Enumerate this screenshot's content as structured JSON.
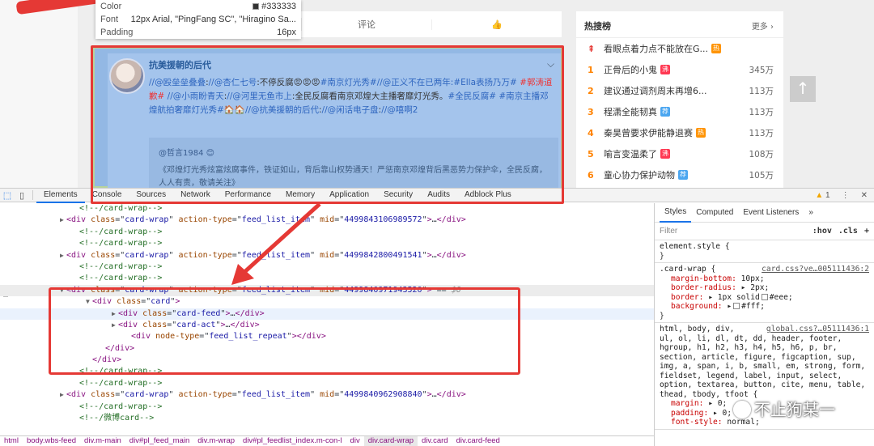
{
  "tooltip": {
    "color_label": "Color",
    "color_value": "#333333",
    "font_label": "Font",
    "font_value": "12px Arial, \"PingFang SC\", \"Hiragino Sa...",
    "padding_label": "Padding",
    "padding_value": "16px"
  },
  "feed_tabs": {
    "comment": "评论",
    "like_icon": "thumb-up-icon"
  },
  "post": {
    "author": "抗美援朝的后代",
    "text_segments": [
      {
        "t": "//",
        "c": "mention"
      },
      {
        "t": "@殴垒垒叠叠",
        "c": "mention"
      },
      {
        "t": ":",
        "c": ""
      },
      {
        "t": "//@杏仁七号",
        "c": "mention"
      },
      {
        "t": ":不停反腐",
        "c": ""
      },
      {
        "t": "😡😡😡",
        "c": ""
      },
      {
        "t": "#南京灯光秀#",
        "c": "mention"
      },
      {
        "t": "//@正义不在已两年",
        "c": "mention"
      },
      {
        "t": ":#Ella表扬乃万# ",
        "c": "mention"
      },
      {
        "t": "#郭涛道歉#",
        "c": "red"
      },
      {
        "t": " //@小雨盼青天",
        "c": "mention"
      },
      {
        "t": ":",
        "c": ""
      },
      {
        "t": "//@河里无鱼市上",
        "c": "mention"
      },
      {
        "t": ":全民反腐看南京邓煌大主播奢靡灯光秀。",
        "c": ""
      },
      {
        "t": "#全民反腐# #南京主播邓煌航拍奢靡灯光秀#",
        "c": "mention"
      },
      {
        "t": "🏠🏠",
        "c": ""
      },
      {
        "t": "//@抗美援朝的后代",
        "c": "mention"
      },
      {
        "t": ":",
        "c": ""
      },
      {
        "t": "//@闲话电子盘",
        "c": "mention"
      },
      {
        "t": ":",
        "c": ""
      },
      {
        "t": "//@嘻啊2",
        "c": "mention"
      }
    ],
    "quote_author": "@哲言1984",
    "quote_text": "《邓煌灯光秀炫富炫腐事件，铁证如山，背后靠山权势通天！严惩南京邓煌背后黑恶势力保护伞，全民反腐，人人有责，敬请关注》"
  },
  "hot": {
    "title": "热搜榜",
    "more": "更多",
    "items": [
      {
        "rank": "",
        "text": "看眼点着力点不能放在G...",
        "badge": "热",
        "btype": "hot",
        "num": ""
      },
      {
        "rank": "1",
        "text": "正骨后的小鬼",
        "badge": "沸",
        "btype": "new",
        "num": "345万"
      },
      {
        "rank": "2",
        "text": "建议通过调剂周末再增6...",
        "badge": "",
        "btype": "",
        "num": "113万"
      },
      {
        "rank": "3",
        "text": "程潇全能韧真",
        "badge": "荐",
        "btype": "rec",
        "num": "113万"
      },
      {
        "rank": "4",
        "text": "秦昊曾要求伊能静退赛",
        "badge": "热",
        "btype": "hot",
        "num": "113万"
      },
      {
        "rank": "5",
        "text": "喻言变温柔了",
        "badge": "沸",
        "btype": "new",
        "num": "108万"
      },
      {
        "rank": "6",
        "text": "童心协力保护动物",
        "badge": "荐",
        "btype": "rec",
        "num": "105万"
      }
    ]
  },
  "devtools": {
    "tabs": [
      "Elements",
      "Console",
      "Sources",
      "Network",
      "Performance",
      "Memory",
      "Application",
      "Security",
      "Audits",
      "Adblock Plus"
    ],
    "active_tab": "Elements",
    "warning_count": "1"
  },
  "elements": {
    "lines": [
      {
        "indent": 5,
        "tri": "",
        "parts": [
          [
            "cm",
            "<!--/card-wrap-->"
          ]
        ]
      },
      {
        "indent": 4,
        "tri": "▶",
        "parts": [
          [
            "tag",
            "<div "
          ],
          [
            "an",
            "class"
          ],
          [
            "plain",
            "=\""
          ],
          [
            "av",
            "card-wrap"
          ],
          [
            "plain",
            "\" "
          ],
          [
            "an",
            "action-type"
          ],
          [
            "plain",
            "=\""
          ],
          [
            "av",
            "feed_list_item"
          ],
          [
            "plain",
            "\" "
          ],
          [
            "an",
            "mid"
          ],
          [
            "plain",
            "=\""
          ],
          [
            "av",
            "4499843106989572"
          ],
          [
            "plain",
            "\""
          ],
          [
            "tag",
            ">"
          ],
          [
            "plain",
            "…"
          ],
          [
            "tag",
            "</div>"
          ]
        ]
      },
      {
        "indent": 5,
        "tri": "",
        "parts": [
          [
            "cm",
            "<!--/card-wrap-->"
          ]
        ]
      },
      {
        "indent": 5,
        "tri": "",
        "parts": [
          [
            "cm",
            "<!--/card-wrap-->"
          ]
        ]
      },
      {
        "indent": 4,
        "tri": "▶",
        "parts": [
          [
            "tag",
            "<div "
          ],
          [
            "an",
            "class"
          ],
          [
            "plain",
            "=\""
          ],
          [
            "av",
            "card-wrap"
          ],
          [
            "plain",
            "\" "
          ],
          [
            "an",
            "action-type"
          ],
          [
            "plain",
            "=\""
          ],
          [
            "av",
            "feed_list_item"
          ],
          [
            "plain",
            "\" "
          ],
          [
            "an",
            "mid"
          ],
          [
            "plain",
            "=\""
          ],
          [
            "av",
            "4499842800491541"
          ],
          [
            "plain",
            "\""
          ],
          [
            "tag",
            ">"
          ],
          [
            "plain",
            "…"
          ],
          [
            "tag",
            "</div>"
          ]
        ]
      },
      {
        "indent": 5,
        "tri": "",
        "parts": [
          [
            "cm",
            "<!--/card-wrap-->"
          ]
        ]
      },
      {
        "indent": 5,
        "tri": "",
        "parts": [
          [
            "cm",
            "<!--/card-wrap-->"
          ]
        ]
      },
      {
        "indent": 4,
        "tri": "▼",
        "sel": true,
        "parts": [
          [
            "tag",
            "<div "
          ],
          [
            "an",
            "class"
          ],
          [
            "plain",
            "=\""
          ],
          [
            "av",
            "card-wrap"
          ],
          [
            "plain",
            "\" "
          ],
          [
            "an",
            "action-type"
          ],
          [
            "plain",
            "=\""
          ],
          [
            "av",
            "feed_list_item"
          ],
          [
            "plain",
            "\" "
          ],
          [
            "an",
            "mid"
          ],
          [
            "plain",
            "=\""
          ],
          [
            "av",
            "4499840971943520"
          ],
          [
            "plain",
            "\""
          ],
          [
            "tag",
            ">"
          ],
          [
            "plain",
            " == "
          ],
          [
            "dollar",
            "$0"
          ]
        ]
      },
      {
        "indent": 6,
        "tri": "▼",
        "parts": [
          [
            "tag",
            "<div "
          ],
          [
            "an",
            "class"
          ],
          [
            "plain",
            "=\""
          ],
          [
            "av",
            "card"
          ],
          [
            "plain",
            "\""
          ],
          [
            "tag",
            ">"
          ]
        ]
      },
      {
        "indent": 8,
        "tri": "▶",
        "hov": true,
        "parts": [
          [
            "tag",
            "<div "
          ],
          [
            "an",
            "class"
          ],
          [
            "plain",
            "=\""
          ],
          [
            "av",
            "card-feed"
          ],
          [
            "plain",
            "\""
          ],
          [
            "tag",
            ">"
          ],
          [
            "plain",
            "…"
          ],
          [
            "tag",
            "</div>"
          ]
        ]
      },
      {
        "indent": 8,
        "tri": "▶",
        "parts": [
          [
            "tag",
            "<div "
          ],
          [
            "an",
            "class"
          ],
          [
            "plain",
            "=\""
          ],
          [
            "av",
            "card-act"
          ],
          [
            "plain",
            "\""
          ],
          [
            "tag",
            ">"
          ],
          [
            "plain",
            "…"
          ],
          [
            "tag",
            "</div>"
          ]
        ]
      },
      {
        "indent": 9,
        "tri": "",
        "parts": [
          [
            "tag",
            "<div "
          ],
          [
            "an",
            "node-type"
          ],
          [
            "plain",
            "=\""
          ],
          [
            "av",
            "feed_list_repeat"
          ],
          [
            "plain",
            "\""
          ],
          [
            "tag",
            "></div>"
          ]
        ]
      },
      {
        "indent": 7,
        "tri": "",
        "parts": [
          [
            "tag",
            "</div>"
          ]
        ]
      },
      {
        "indent": 6,
        "tri": "",
        "parts": [
          [
            "tag",
            "</div>"
          ]
        ]
      },
      {
        "indent": 5,
        "tri": "",
        "parts": [
          [
            "cm",
            "<!--/card-wrap-->"
          ]
        ]
      },
      {
        "indent": 5,
        "tri": "",
        "parts": [
          [
            "cm",
            "<!--/card-wrap-->"
          ]
        ]
      },
      {
        "indent": 4,
        "tri": "▶",
        "parts": [
          [
            "tag",
            "<div "
          ],
          [
            "an",
            "class"
          ],
          [
            "plain",
            "=\""
          ],
          [
            "av",
            "card-wrap"
          ],
          [
            "plain",
            "\" "
          ],
          [
            "an",
            "action-type"
          ],
          [
            "plain",
            "=\""
          ],
          [
            "av",
            "feed_list_item"
          ],
          [
            "plain",
            "\" "
          ],
          [
            "an",
            "mid"
          ],
          [
            "plain",
            "=\""
          ],
          [
            "av",
            "4499840962908840"
          ],
          [
            "plain",
            "\""
          ],
          [
            "tag",
            ">"
          ],
          [
            "plain",
            "…"
          ],
          [
            "tag",
            "</div>"
          ]
        ]
      },
      {
        "indent": 5,
        "tri": "",
        "parts": [
          [
            "cm",
            "<!--/card-wrap-->"
          ]
        ]
      },
      {
        "indent": 5,
        "tri": "",
        "parts": [
          [
            "cm",
            "<!--/微博card-->"
          ]
        ]
      }
    ]
  },
  "breadcrumb": [
    "html",
    "body.wbs-feed",
    "div.m-main",
    "div#pl_feed_main",
    "div.m-wrap",
    "div#pl_feedlist_index.m-con-l",
    "div",
    "div.card-wrap",
    "div.card",
    "div.card-feed"
  ],
  "breadcrumb_current": "div.card-wrap",
  "styles": {
    "tabs": [
      "Styles",
      "Computed",
      "Event Listeners",
      "»"
    ],
    "filter_placeholder": "Filter",
    "hov": ":hov",
    "cls": ".cls",
    "plus": "+",
    "element_style": "element.style {",
    "close": "}",
    "rule1_selector": ".card-wrap {",
    "rule1_source": "card.css?ve…005111436:2",
    "rule1_props": [
      {
        "name": "margin-bottom",
        "value": "10px;",
        "box": false
      },
      {
        "name": "border-radius",
        "value": "▸ 2px;",
        "box": false
      },
      {
        "name": "border",
        "value": "▸ 1px solid",
        "box": true,
        "after": "#eee;"
      },
      {
        "name": "background",
        "value": "▸",
        "box": true,
        "after": "#fff;"
      }
    ],
    "rule2_source": "global.css?…05111436:1",
    "rule2_lines": [
      "html, body, div,",
      "ul, ol, li, dl, dt, dd, header, footer,",
      "hgroup, h1, h2, h3, h4, h5, h6, p, br,",
      "section, article, figure, figcaption, sup,",
      "img, a, span, i, b, small, em, strong, form,",
      "fieldset, legend, label, input, select,",
      "option, textarea, button, cite, menu, table,",
      "thead, tbody, tfoot {"
    ],
    "rule2_props": [
      {
        "name": "margin",
        "value": "▸ 0;"
      },
      {
        "name": "padding",
        "value": "▸ 0;"
      },
      {
        "name": "font-style",
        "value": "normal;"
      }
    ]
  },
  "watermark": "不止狗某一"
}
